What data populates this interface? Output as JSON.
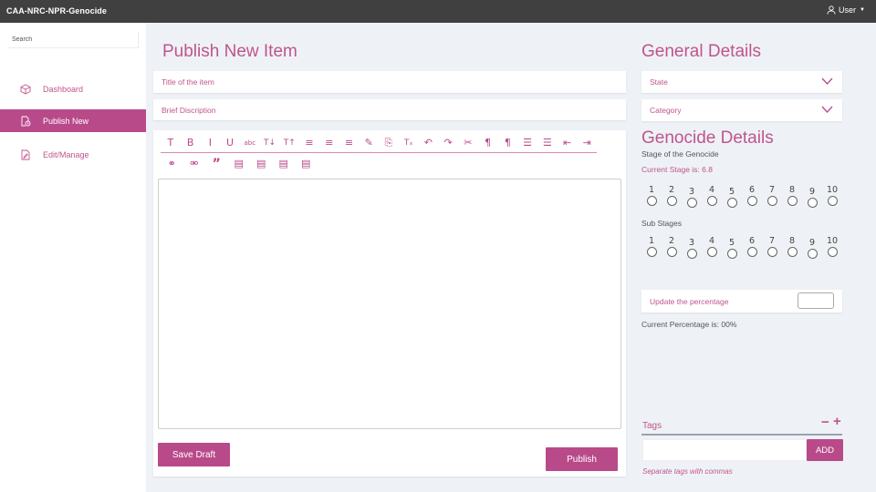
{
  "app": {
    "title": "CAA-NRC-NPR-Genocide",
    "user_label": "User"
  },
  "sidebar": {
    "search_placeholder": "Search",
    "items": [
      {
        "label": "Dashboard",
        "icon": "cube-icon",
        "active": false
      },
      {
        "label": "Publish New",
        "icon": "document-clock-icon",
        "active": true
      },
      {
        "label": "Edit/Manage",
        "icon": "document-edit-icon",
        "active": false
      }
    ]
  },
  "main": {
    "title": "Publish New Item",
    "title_placeholder": "Title of the item",
    "description_placeholder": "Brief Discription",
    "toolbar_row1": [
      "T",
      "B",
      "I",
      "U",
      "abc",
      "T↓",
      "T↑",
      "≡",
      "≡",
      "≡",
      "✎",
      "⎘",
      "Tₓ",
      "↶",
      "↷",
      "✂",
      "¶",
      "¶",
      "☰",
      "☰",
      "⇤",
      "⇥"
    ],
    "toolbar_row2": [
      "⚭",
      "⚮",
      "”",
      "▤",
      "▤",
      "▤",
      "▤"
    ],
    "save_draft_label": "Save Draft",
    "publish_label": "Publish"
  },
  "general": {
    "title": "General Details",
    "state_label": "State",
    "category_label": "Category"
  },
  "genocide": {
    "title": "Genocide Details",
    "stage_label": "Stage of the Genocide",
    "current_stage_text": "Current Stage is: 6.8",
    "stage_numbers": [
      "1",
      "2",
      "3",
      "4",
      "5",
      "6",
      "7",
      "8",
      "9",
      "10"
    ],
    "sub_stage_label": "Sub Stages",
    "sub_stage_numbers": [
      "1",
      "2",
      "3",
      "4",
      "5",
      "6",
      "7",
      "8",
      "9",
      "10"
    ],
    "update_percentage_label": "Update the percentage",
    "current_percentage_text": "Current Percentage is: 00%"
  },
  "tags": {
    "label": "Tags",
    "minus": "−",
    "plus": "+",
    "add_label": "ADD",
    "hint": "Separate tags with commas"
  },
  "colors": {
    "accent": "#b94a8a",
    "topbar": "#404040",
    "background": "#eef2f6"
  }
}
